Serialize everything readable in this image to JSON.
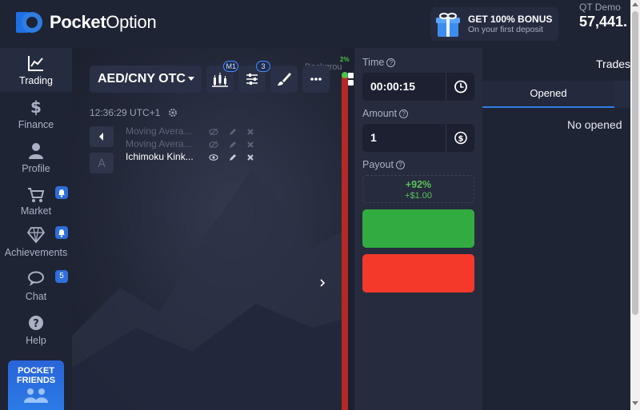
{
  "brand": {
    "name_bold": "Pocket",
    "name_regular": "Option"
  },
  "bonus": {
    "title": "GET 100% BONUS",
    "subtitle": "On your first deposit"
  },
  "account": {
    "type": "QT Demo",
    "balance": "57,441."
  },
  "sidebar": {
    "items": [
      {
        "label": "Trading",
        "icon": "chart-icon"
      },
      {
        "label": "Finance",
        "icon": "dollar-icon"
      },
      {
        "label": "Profile",
        "icon": "user-icon"
      },
      {
        "label": "Market",
        "icon": "cart-icon"
      },
      {
        "label": "Achievements",
        "icon": "diamond-icon"
      },
      {
        "label": "Chat",
        "icon": "chat-icon",
        "badge": "5"
      },
      {
        "label": "Help",
        "icon": "help-icon"
      }
    ],
    "friends": {
      "line1": "POCKET",
      "line2": "FRIENDS"
    }
  },
  "chart": {
    "pair": "AED/CNY OTC",
    "timeframe_badge": "M1",
    "indicators_badge": "3",
    "time": "12:36:29 UTC+1",
    "side_letter": "A",
    "partial_label": "Background",
    "indicators": [
      {
        "name": "Moving Avera...",
        "visible": false
      },
      {
        "name": "Moving Avera...",
        "visible": false
      },
      {
        "name": "Ichimoku Kink...",
        "visible": true
      }
    ]
  },
  "sentiment": {
    "percent": "2%",
    "value": 0.02
  },
  "trade": {
    "time_label": "Time",
    "time_value": "00:00:15",
    "amount_label": "Amount",
    "amount_value": "1",
    "payout_label": "Payout",
    "payout_pct": "+92%",
    "payout_amt": "+$1.00"
  },
  "trades": {
    "title": "Trades",
    "tab_opened": "Opened",
    "empty": "No opened"
  },
  "colors": {
    "call": "#32ac41",
    "put": "#f4392b",
    "accent": "#2f7de1"
  }
}
